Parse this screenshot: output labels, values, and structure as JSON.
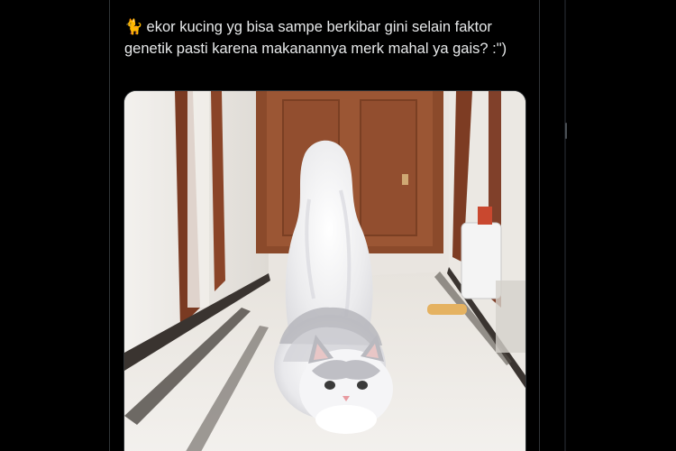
{
  "tweet": {
    "emoji": "🐈",
    "text": "ekor kucing yg bisa sampe berkibar gini selain faktor genetik pasti karena makanannya merk mahal ya gais? :\")"
  },
  "media": {
    "type": "photo",
    "icon": "cat-photo"
  }
}
